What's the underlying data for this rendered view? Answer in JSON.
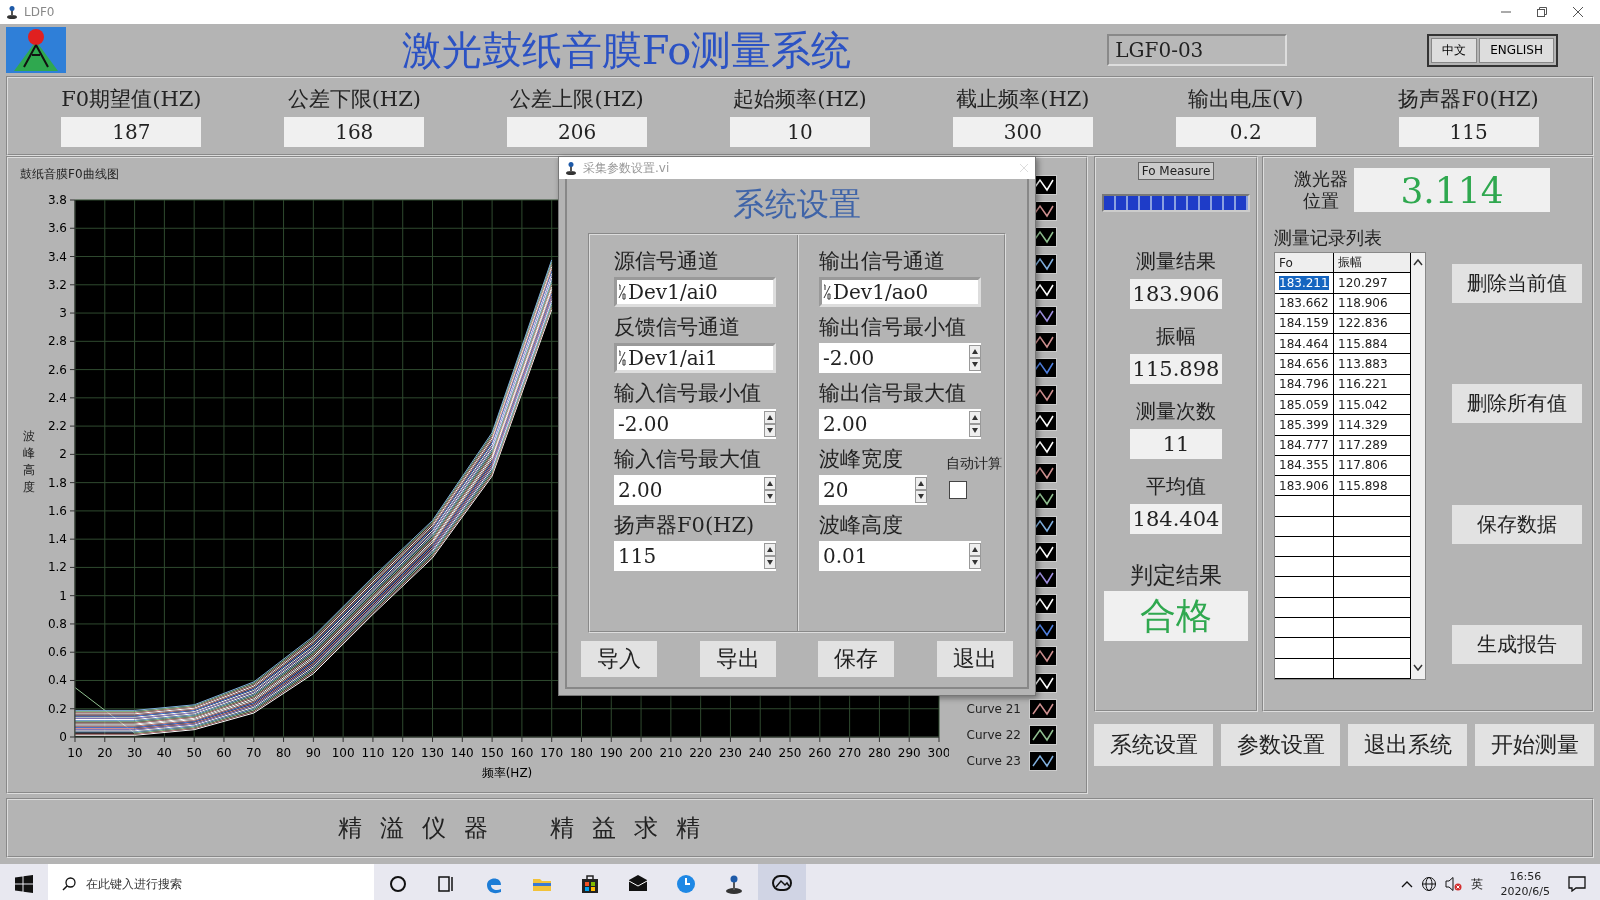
{
  "window": {
    "title": "LDF0"
  },
  "header": {
    "title": "激光鼓纸音膜Fo测量系统",
    "model": "LGF0-03",
    "languages": [
      {
        "label": "中文"
      },
      {
        "label": "ENGLISH"
      }
    ]
  },
  "params": [
    {
      "label": "F0期望值(HZ)",
      "value": "187"
    },
    {
      "label": "公差下限(HZ)",
      "value": "168"
    },
    {
      "label": "公差上限(HZ)",
      "value": "206"
    },
    {
      "label": "起始频率(HZ)",
      "value": "10"
    },
    {
      "label": "截止频率(HZ)",
      "value": "300"
    },
    {
      "label": "输出电压(V)",
      "value": "0.2"
    },
    {
      "label": "扬声器F0(HZ)",
      "value": "115"
    }
  ],
  "chart": {
    "title": "鼓纸音膜F0曲线图",
    "chart_data": {
      "type": "line",
      "xlabel": "频率(HZ)",
      "ylabel": "波峰高度",
      "x": [
        10,
        30,
        50,
        70,
        90,
        110,
        130,
        150,
        170
      ],
      "grid": true,
      "xlim": [
        10,
        300
      ],
      "ylim": [
        0,
        3.8
      ],
      "xticks": [
        10,
        20,
        30,
        40,
        50,
        60,
        70,
        80,
        90,
        100,
        110,
        120,
        130,
        140,
        150,
        160,
        170,
        180,
        190,
        200,
        210,
        220,
        230,
        240,
        250,
        260,
        270,
        280,
        290,
        300
      ],
      "yticks": [
        0,
        0.2,
        0.4,
        0.6,
        0.8,
        1,
        1.2,
        1.4,
        1.6,
        1.8,
        2,
        2.2,
        2.4,
        2.6,
        2.8,
        3,
        3.2,
        3.4,
        3.6,
        3.8
      ],
      "series": [
        {
          "color": "#ffffff",
          "values": [
            0.012,
            0.012,
            0.052,
            0.17,
            0.448,
            0.868,
            1.268,
            1.846,
            3.024
          ]
        },
        {
          "color": "#d09090",
          "values": [
            0.02,
            0.02,
            0.06,
            0.18,
            0.46,
            0.88,
            1.28,
            1.86,
            3.04
          ]
        },
        {
          "color": "#90c090",
          "values": [
            0.35,
            0.028,
            0.068,
            0.19,
            0.472,
            0.892,
            1.292,
            1.874,
            3.056
          ]
        },
        {
          "color": "#80b0e0",
          "values": [
            0.036,
            0.036,
            0.076,
            0.2,
            0.484,
            0.904,
            1.304,
            1.888,
            3.072
          ]
        },
        {
          "color": "#ffffff",
          "values": [
            0.044,
            0.044,
            0.084,
            0.21,
            0.496,
            0.916,
            1.316,
            1.902,
            3.088
          ]
        },
        {
          "color": "#a090e0",
          "values": [
            0.052,
            0.052,
            0.092,
            0.22,
            0.508,
            0.928,
            1.328,
            1.916,
            3.104
          ]
        },
        {
          "color": "#d09090",
          "values": [
            0.06,
            0.06,
            0.1,
            0.23,
            0.52,
            0.94,
            1.34,
            1.93,
            3.12
          ]
        },
        {
          "color": "#5080e0",
          "values": [
            0.068,
            0.068,
            0.108,
            0.24,
            0.532,
            0.952,
            1.352,
            1.944,
            3.136
          ]
        },
        {
          "color": "#d09090",
          "values": [
            0.076,
            0.076,
            0.116,
            0.25,
            0.544,
            0.964,
            1.364,
            1.958,
            3.152
          ]
        },
        {
          "color": "#ffffff",
          "values": [
            0.084,
            0.084,
            0.124,
            0.26,
            0.556,
            0.976,
            1.376,
            1.972,
            3.168
          ]
        },
        {
          "color": "#ffffff",
          "values": [
            0.092,
            0.092,
            0.132,
            0.27,
            0.568,
            0.988,
            1.388,
            1.986,
            3.184
          ]
        },
        {
          "color": "#d09090",
          "values": [
            0.1,
            0.1,
            0.14,
            0.28,
            0.58,
            1.0,
            1.4,
            2.0,
            3.2
          ]
        },
        {
          "color": "#90c090",
          "values": [
            0.108,
            0.108,
            0.148,
            0.29,
            0.592,
            1.012,
            1.412,
            2.014,
            3.216
          ]
        },
        {
          "color": "#80b0e0",
          "values": [
            0.116,
            0.116,
            0.156,
            0.3,
            0.604,
            1.024,
            1.424,
            2.028,
            3.232
          ]
        },
        {
          "color": "#ffffff",
          "values": [
            0.124,
            0.124,
            0.164,
            0.31,
            0.616,
            1.036,
            1.436,
            2.042,
            3.248
          ]
        },
        {
          "color": "#a090e0",
          "values": [
            0.132,
            0.132,
            0.172,
            0.32,
            0.628,
            1.048,
            1.448,
            2.056,
            3.264
          ]
        },
        {
          "color": "#ffffff",
          "values": [
            0.14,
            0.14,
            0.18,
            0.33,
            0.64,
            1.06,
            1.46,
            2.07,
            3.28
          ]
        },
        {
          "color": "#5080e0",
          "values": [
            0.148,
            0.148,
            0.188,
            0.34,
            0.652,
            1.072,
            1.472,
            2.084,
            3.296
          ]
        },
        {
          "color": "#d09090",
          "values": [
            0.156,
            0.156,
            0.196,
            0.35,
            0.664,
            1.084,
            1.484,
            2.098,
            3.312
          ]
        },
        {
          "color": "#ffffff",
          "values": [
            0.164,
            0.164,
            0.204,
            0.36,
            0.676,
            1.096,
            1.496,
            2.112,
            3.328
          ]
        },
        {
          "name": "Curve 21",
          "color": "#d09090",
          "values": [
            0.172,
            0.172,
            0.212,
            0.37,
            0.688,
            1.108,
            1.508,
            2.126,
            3.344
          ]
        },
        {
          "name": "Curve 22",
          "color": "#90c090",
          "values": [
            0.18,
            0.18,
            0.22,
            0.38,
            0.7,
            1.12,
            1.52,
            2.14,
            3.36
          ]
        },
        {
          "name": "Curve 23",
          "color": "#80b0e0",
          "values": [
            0.188,
            0.188,
            0.228,
            0.39,
            0.712,
            1.132,
            1.532,
            2.154,
            3.376
          ]
        }
      ]
    }
  },
  "dialog": {
    "title": "采集参数设置.vi",
    "heading": "系统设置",
    "columns": [
      [
        {
          "label": "源信号通道",
          "value": "Dev1/ai0",
          "kind": "channel"
        },
        {
          "label": "反馈信号通道",
          "value": "Dev1/ai1",
          "kind": "channel"
        },
        {
          "label": "输入信号最小值",
          "value": "-2.00",
          "kind": "numeric"
        },
        {
          "label": "输入信号最大值",
          "value": "2.00",
          "kind": "numeric"
        },
        {
          "label": "扬声器F0(HZ)",
          "value": "115",
          "kind": "numeric"
        }
      ],
      [
        {
          "label": "输出信号通道",
          "value": "Dev1/ao0",
          "kind": "channel"
        },
        {
          "label": "输出信号最小值",
          "value": "-2.00",
          "kind": "numeric"
        },
        {
          "label": "输出信号最大值",
          "value": "2.00",
          "kind": "numeric"
        },
        {
          "label": "波峰宽度",
          "value": "20",
          "kind": "numeric",
          "option": {
            "label": "自动计算",
            "checked": false
          }
        },
        {
          "label": "波峰高度",
          "value": "0.01",
          "kind": "numeric"
        }
      ]
    ],
    "buttons": [
      "导入",
      "导出",
      "保存",
      "退出"
    ]
  },
  "measure": {
    "caption": "Fo Measure",
    "progress": {
      "level": 1
    },
    "readings": [
      {
        "label": "测量结果",
        "value": "183.906"
      },
      {
        "label": "振幅",
        "value": "115.898"
      },
      {
        "label": "测量次数",
        "value": "11"
      },
      {
        "label": "平均值",
        "value": "184.404"
      }
    ],
    "verdict": {
      "label": "判定结果",
      "value": "合格"
    }
  },
  "records": {
    "laser_label": "激光器位置",
    "laser_value": "3.114",
    "title": "测量记录列表",
    "columns": [
      "Fo",
      "振幅"
    ],
    "rows": [
      {
        "cells": [
          "183.211",
          "120.297"
        ],
        "selected": true
      },
      {
        "cells": [
          "183.662",
          "118.906"
        ],
        "selected": false
      },
      {
        "cells": [
          "184.159",
          "122.836"
        ],
        "selected": false
      },
      {
        "cells": [
          "184.464",
          "115.884"
        ],
        "selected": false
      },
      {
        "cells": [
          "184.656",
          "113.883"
        ],
        "selected": false
      },
      {
        "cells": [
          "184.796",
          "116.221"
        ],
        "selected": false
      },
      {
        "cells": [
          "185.059",
          "115.042"
        ],
        "selected": false
      },
      {
        "cells": [
          "185.399",
          "114.329"
        ],
        "selected": false
      },
      {
        "cells": [
          "184.777",
          "117.289"
        ],
        "selected": false
      },
      {
        "cells": [
          "184.355",
          "117.806"
        ],
        "selected": false
      },
      {
        "cells": [
          "183.906",
          "115.898"
        ],
        "selected": false
      }
    ],
    "buttons": [
      "删除当前值",
      "删除所有值",
      "保存数据",
      "生成报告"
    ]
  },
  "actions": [
    "系统设置",
    "参数设置",
    "退出系统",
    "开始测量"
  ],
  "footer": [
    "精溢仪器",
    "精益求精"
  ],
  "taskbar": {
    "search_placeholder": "在此键入进行搜索",
    "apps": [
      {
        "kind": "cortana",
        "active": false
      },
      {
        "kind": "taskview",
        "active": false
      },
      {
        "kind": "edge",
        "active": false
      },
      {
        "kind": "explorer",
        "active": false
      },
      {
        "kind": "store",
        "active": false
      },
      {
        "kind": "mail",
        "active": false
      },
      {
        "kind": "clock",
        "active": false
      },
      {
        "kind": "joystick",
        "active": false
      },
      {
        "kind": "photos",
        "active": true
      }
    ],
    "ime": "英",
    "time": "16:56",
    "date": "2020/6/5"
  }
}
